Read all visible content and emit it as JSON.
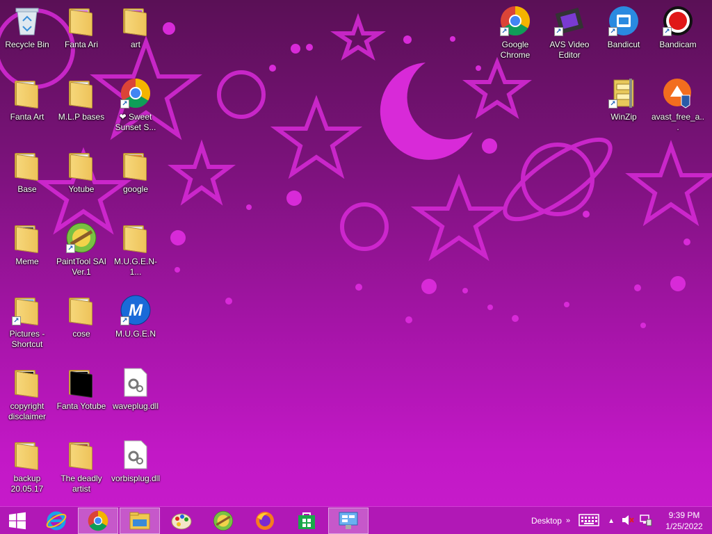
{
  "desktop_icons": {
    "recycle_bin": "Recycle Bin",
    "fanta_ari": "Fanta Ari",
    "art": "art",
    "fanta_art": "Fanta Art",
    "mlp_bases": "M.L.P bases",
    "sweet_sunset": "❤ Sweet Sunset S...",
    "base": "Base",
    "yotube": "Yotube",
    "google": "google",
    "meme": "Meme",
    "painttool_sai": "PaintTool SAI Ver.1",
    "mugen_folder": "M.U.G.E.N-1...",
    "pictures_shortcut": "Pictures - Shortcut",
    "cose": "cose",
    "mugen": "M.U.G.E.N",
    "copyright_disclaimer": "copyright disclaimer",
    "fanta_yotube": "Fanta Yotube",
    "waveplug": "waveplug.dll",
    "backup": "backup 20.05.17",
    "deadly_artist": "The deadly artist",
    "vorbisplug": "vorbisplug.dll",
    "google_chrome": "Google Chrome",
    "avs_video_editor": "AVS Video Editor",
    "bandicut": "Bandicut",
    "bandicam": "Bandicam",
    "winzip": "WinZip",
    "avast": "avast_free_a..."
  },
  "taskbar": {
    "items": [
      {
        "icon": "windows-start-icon"
      },
      {
        "icon": "internet-explorer-icon"
      },
      {
        "icon": "chrome-icon",
        "active": true
      },
      {
        "icon": "file-explorer-icon",
        "active": true
      },
      {
        "icon": "paint-palette-icon"
      },
      {
        "icon": "painttool-sai-icon"
      },
      {
        "icon": "firefox-icon"
      },
      {
        "icon": "store-icon"
      },
      {
        "icon": "control-panel-icon",
        "active": true
      }
    ],
    "desktop_label": "Desktop",
    "chevron": "»",
    "clock_time": "9:39 PM",
    "clock_date": "1/25/2022"
  },
  "colors": {
    "wallpaper_top": "#5a1056",
    "wallpaper_bottom": "#c81ccc",
    "taskbar": "#b118b6",
    "decoration": "#e030e0"
  }
}
